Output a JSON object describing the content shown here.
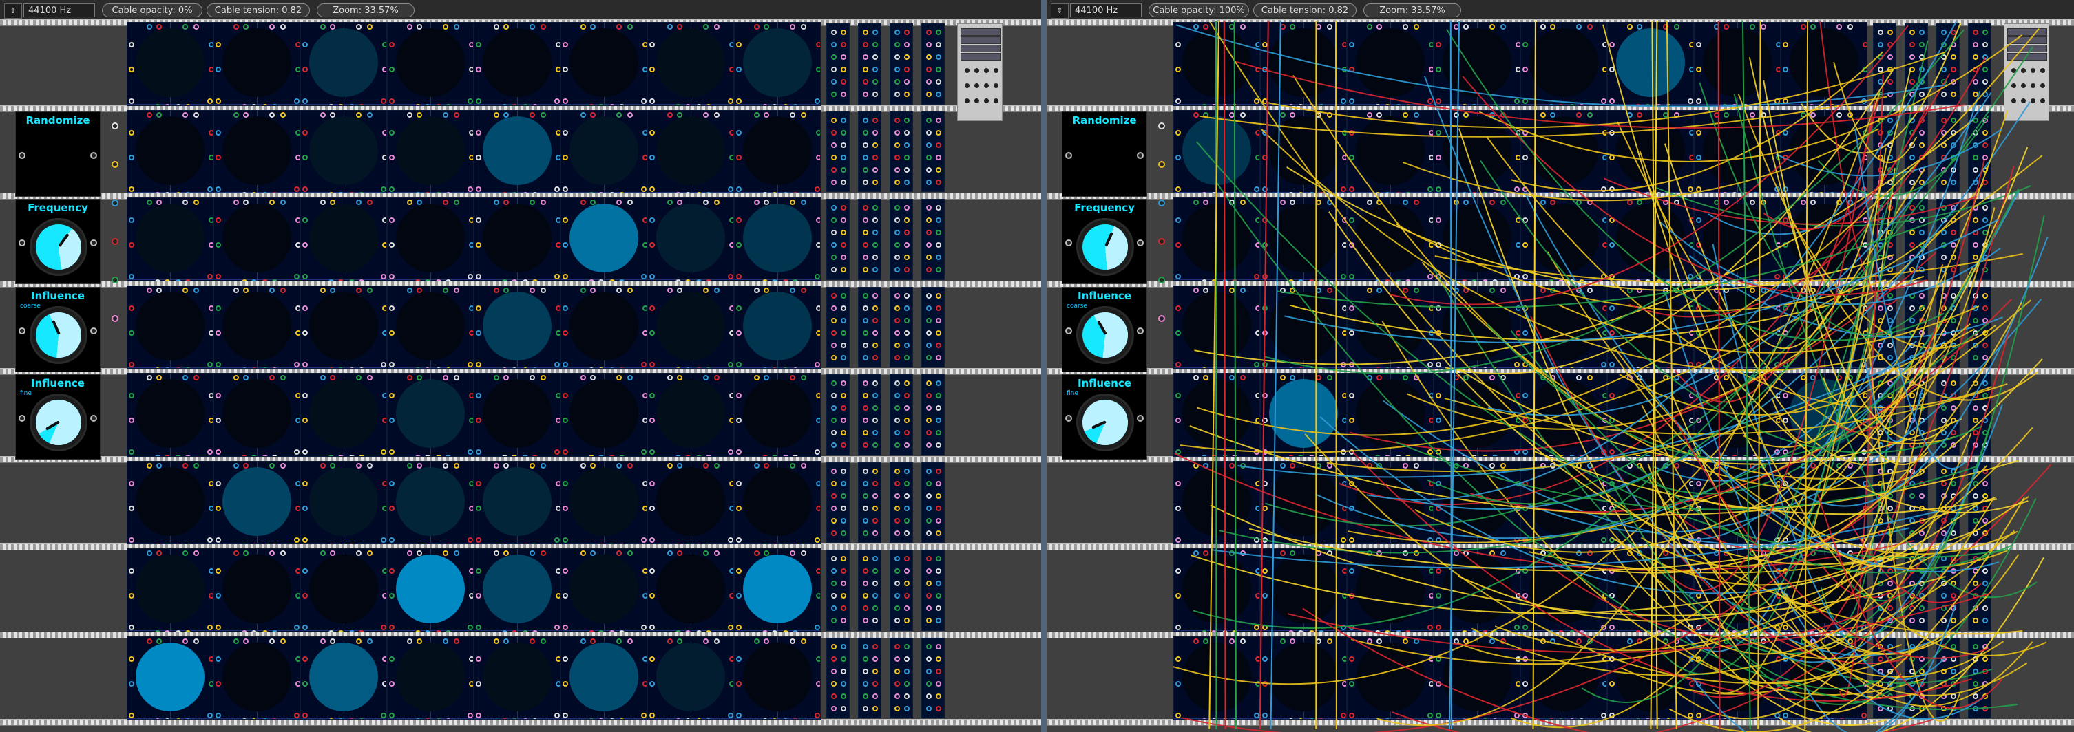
{
  "panes": [
    {
      "id": "left",
      "toolbar": {
        "sample_rate": "44100 Hz",
        "cable_opacity": "Cable opacity: 0%",
        "cable_tension": "Cable tension: 0.82",
        "zoom": "Zoom: 33.57%"
      },
      "cable_opacity": 0,
      "controls": [
        {
          "title": "Randomize",
          "sub": "",
          "knob": null
        },
        {
          "title": "Frequency",
          "sub": "",
          "knob": 0.62
        },
        {
          "title": "Influence",
          "sub": "coarse",
          "knob": 0.42
        },
        {
          "title": "Influence",
          "sub": "fine",
          "knob": 0.1
        }
      ],
      "grid_intensity": [
        [
          0.05,
          0.0,
          0.25,
          0.0,
          0.0,
          0.0,
          0.05,
          0.2
        ],
        [
          0.0,
          0.0,
          0.1,
          0.05,
          0.45,
          0.1,
          0.05,
          0.0
        ],
        [
          0.05,
          0.0,
          0.05,
          0.0,
          0.0,
          0.7,
          0.15,
          0.3
        ],
        [
          0.0,
          0.0,
          0.0,
          0.0,
          0.35,
          0.0,
          0.05,
          0.3
        ],
        [
          0.0,
          0.0,
          0.05,
          0.2,
          0.0,
          0.0,
          0.05,
          0.0
        ],
        [
          0.0,
          0.4,
          0.1,
          0.2,
          0.2,
          0.05,
          0.0,
          0.0
        ],
        [
          0.05,
          0.0,
          0.0,
          0.85,
          0.4,
          0.05,
          0.0,
          0.85
        ],
        [
          0.85,
          0.0,
          0.55,
          0.05,
          0.05,
          0.45,
          0.15,
          0.0
        ]
      ]
    },
    {
      "id": "right",
      "toolbar": {
        "sample_rate": "44100 Hz",
        "cable_opacity": "Cable opacity: 100%",
        "cable_tension": "Cable tension: 0.82",
        "zoom": "Zoom: 33.57%"
      },
      "cable_opacity": 1,
      "controls": [
        {
          "title": "Randomize",
          "sub": "",
          "knob": null
        },
        {
          "title": "Frequency",
          "sub": "",
          "knob": 0.58
        },
        {
          "title": "Influence",
          "sub": "coarse",
          "knob": 0.4
        },
        {
          "title": "Influence",
          "sub": "fine",
          "knob": 0.12
        }
      ],
      "grid_intensity": [
        [
          0.0,
          0.0,
          0.0,
          0.0,
          0.0,
          0.5,
          0.0,
          0.0
        ],
        [
          0.3,
          0.0,
          0.0,
          0.0,
          0.0,
          0.0,
          0.0,
          0.0
        ],
        [
          0.0,
          0.0,
          0.0,
          0.0,
          0.0,
          0.0,
          0.0,
          0.0
        ],
        [
          0.0,
          0.0,
          0.0,
          0.0,
          0.0,
          0.0,
          0.0,
          0.0
        ],
        [
          0.0,
          0.65,
          0.0,
          0.0,
          0.0,
          0.0,
          0.0,
          0.3
        ],
        [
          0.0,
          0.0,
          0.0,
          0.0,
          0.0,
          0.0,
          0.0,
          0.0
        ],
        [
          0.0,
          0.0,
          0.0,
          0.0,
          0.0,
          0.0,
          0.0,
          0.0
        ],
        [
          0.0,
          0.0,
          0.0,
          0.0,
          0.0,
          0.0,
          0.0,
          0.0
        ]
      ]
    }
  ],
  "colors": {
    "accent": "#16e9ff",
    "module_bg": "#000a26",
    "cables": [
      "#f0c419",
      "#e8c21a",
      "#2e9bd6",
      "#d7262f",
      "#22a04a",
      "#f5d42b"
    ],
    "jack": [
      "#dddddd",
      "#f0c419",
      "#2e9bd6",
      "#d7262f",
      "#22a04a",
      "#e98bd4"
    ]
  },
  "icons": {
    "spin": "spinner-icon",
    "knob": "knob-icon",
    "jack": "jack-icon",
    "light": "light-icon"
  }
}
